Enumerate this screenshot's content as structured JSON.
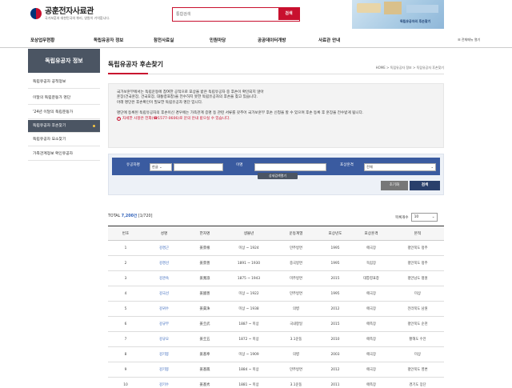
{
  "header": {
    "logo_title": "공훈전자사료관",
    "logo_sub": "국가보훈처 대한민국의 뿌리, 영원히 기억합니다.",
    "search_placeholder": "통합검색",
    "search_button": "검색",
    "banner_text": "독립유공자의 후손찾기"
  },
  "nav": {
    "items": [
      "포상업무현황",
      "독립유공자 정보",
      "참전사료실",
      "민원마당",
      "공공데이터개방",
      "사료관 안내"
    ],
    "sitemap": "전체메뉴 열기"
  },
  "sidebar": {
    "title": "독립유공자 정보",
    "items": [
      {
        "label": "독립유공자 공적정보",
        "active": false
      },
      {
        "label": "이달의 독립운동가 명단",
        "active": false
      },
      {
        "label": "'24년 이달의 독립운동가",
        "active": false
      },
      {
        "label": "독립유공자 후손찾기",
        "active": true
      },
      {
        "label": "독립유공자 묘소찾기",
        "active": false
      },
      {
        "label": "가족관계정보 확인유공자",
        "active": false
      }
    ]
  },
  "main": {
    "title": "독립유공자 후손찾기",
    "breadcrumb": "HOME > 독립유공자 정보 > 독립유공자 후손찾기",
    "info": {
      "lines1": [
        "국가보훈부에서는 독립운동에 참여한 공적으로 포상을 받은 독립유공자 중 후손이 확인되지 않아",
        "훈장(건국훈장, 건국포장, 대통령표창)을 전수하지 못한 독립유공자의 후손을 찾고 있습니다.",
        "아래 명단은 후손확인이 필요한 독립유공자 명단 입니다."
      ],
      "lines2": [
        "명단에 등록된 독립유공자의 후손이신 경우에는 가족관계 증명 등 관련 서류를 갖추어 국가보훈부 후손 신청을 할 수 있으며 후손 등록 후 훈장을 전수받게 됩니다."
      ],
      "warning": "자세한 사항은 전화(☎1577-0606)로 문의 안내 받으실 수 있습니다."
    },
    "form": {
      "label_type": "유공자명",
      "type_value": "한글",
      "label_name": "이명",
      "label_award": "포상훈격",
      "award_value": "전체",
      "detail_button": "상세검색열기",
      "reset_button": "초기화",
      "search_button": "검색"
    },
    "total_label": "TOTAL",
    "total_count": "7,200건",
    "total_page": "[1/720]",
    "perpage_label": "목록개수",
    "perpage_value": "10",
    "table": {
      "headers": [
        "번호",
        "성명",
        "한자명",
        "생몰년",
        "운동계열",
        "포상년도",
        "포상훈격",
        "본적"
      ],
      "rows": [
        [
          "1",
          "강경근",
          "姜景根",
          "미상 ~ 1924",
          "만주방면",
          "1995",
          "애국장",
          "평안북도 정주"
        ],
        [
          "2",
          "강경선",
          "姜景善",
          "1891 ~ 1930",
          "중국방면",
          "1995",
          "독립장",
          "평안북도 정주"
        ],
        [
          "3",
          "강관숙",
          "姜寬淑",
          "1875 ~ 1943",
          "미주방면",
          "2015",
          "대통령표창",
          "평안남도 평원"
        ],
        [
          "4",
          "강국선",
          "姜國善",
          "미상 ~ 1922",
          "만주방면",
          "1995",
          "애국장",
          "미상"
        ],
        [
          "5",
          "강귀수",
          "姜貴洙",
          "미상 ~ 1938",
          "의병",
          "2012",
          "애국장",
          "전라북도 남원"
        ],
        [
          "6",
          "강규무",
          "姜圭武",
          "1887 ~ 미상",
          "국내항일",
          "2015",
          "애족장",
          "평안북도 순천"
        ],
        [
          "7",
          "강규오",
          "姜圭五",
          "1872 ~ 미상",
          "3.1운동",
          "2010",
          "애족장",
          "황해도 수안"
        ],
        [
          "8",
          "강기봉",
          "姜基奉",
          "미상 ~ 1909",
          "의병",
          "2003",
          "애국장",
          "미상"
        ],
        [
          "9",
          "강기봉",
          "姜基鳳",
          "1884 ~ 미상",
          "만주방면",
          "2012",
          "애국장",
          "평안북도 영변"
        ],
        [
          "10",
          "강기수",
          "姜基秀",
          "1881 ~ 미상",
          "3.1운동",
          "2011",
          "애족장",
          "경기도 장단"
        ]
      ]
    }
  },
  "colors": {
    "accent_red": "#c8102e",
    "sidebar_dark": "#4b5563",
    "form_blue": "#3a5ba0",
    "link_blue": "#2d5fb8"
  }
}
